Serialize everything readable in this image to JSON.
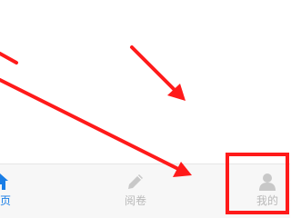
{
  "tabs": [
    {
      "key": "home",
      "label": "首页",
      "icon": "home-icon",
      "active": true
    },
    {
      "key": "exam",
      "label": "阅卷",
      "icon": "pencil-icon",
      "active": false
    },
    {
      "key": "mine",
      "label": "我的",
      "icon": "person-icon",
      "active": false
    }
  ],
  "colors": {
    "active": "#1a7ee6",
    "inactive": "#b9b9b9",
    "annotation": "#ff1a1a",
    "tab_bar_bg": "#f7f7f7"
  }
}
